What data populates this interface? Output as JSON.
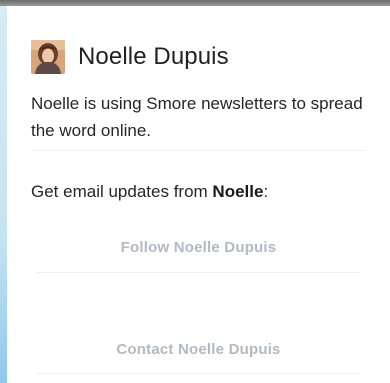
{
  "profile": {
    "name": "Noelle Dupuis",
    "avatar_icon": "user-photo-avatar",
    "description": "Noelle is using Smore newsletters to spread the word online."
  },
  "updates": {
    "prefix": "Get email updates from ",
    "first_name": "Noelle",
    "suffix": ":"
  },
  "actions": {
    "follow_label": "Follow Noelle Dupuis",
    "contact_label": "Contact Noelle Dupuis"
  },
  "colors": {
    "action_text": "#b3b9c3",
    "top_border": "#6b6b6b",
    "left_edge": "#8fc8ee"
  }
}
